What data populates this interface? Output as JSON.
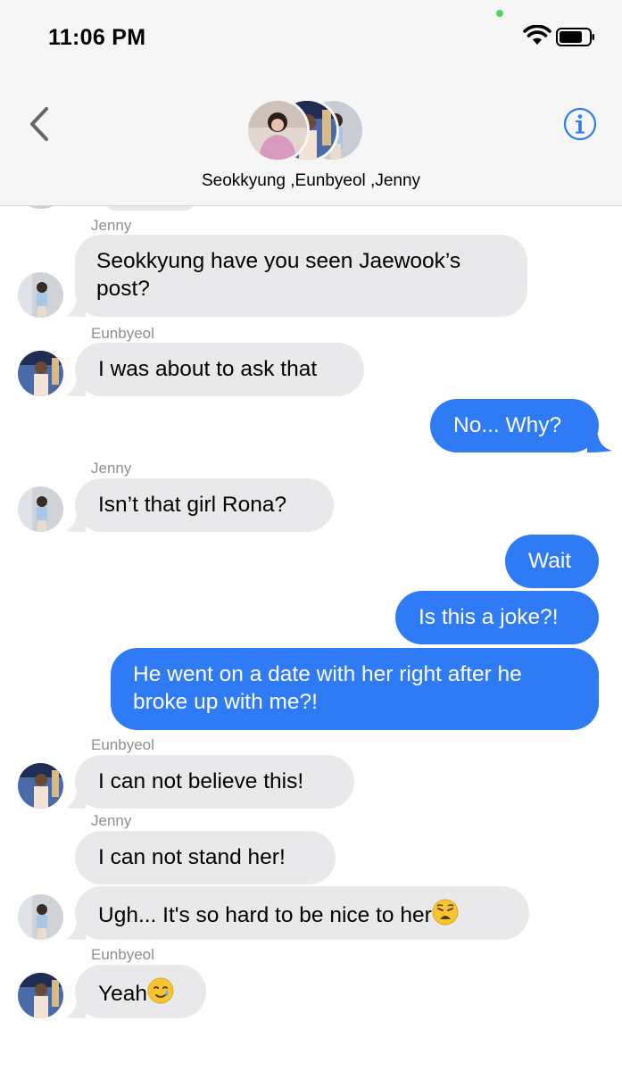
{
  "status_bar": {
    "time": "11:06 PM"
  },
  "nav": {
    "group_names": "Seokkyung ,Eunbyeol ,Jenny"
  },
  "messages": [
    {
      "sender": "Jenny",
      "text": "Seokkyung have you seen Jaewook’s post?",
      "line1": "Seokkyung have you seen Jaewook’s",
      "line2": "post?"
    },
    {
      "sender": "Eunbyeol",
      "text": "I was about to ask that"
    },
    {
      "text": "No... Why?"
    },
    {
      "sender": "Jenny",
      "text": "Isn’t that girl Rona?"
    },
    {
      "text": "Wait"
    },
    {
      "text": "Is this a joke?!"
    },
    {
      "text": "He went on a date with her right after he broke up with me?!",
      "line1": "He went on a date with her right after he",
      "line2": "broke up with me?!"
    },
    {
      "sender": "Eunbyeol",
      "text": "I can not believe this!"
    },
    {
      "sender": "Jenny",
      "text": "I can not stand her!"
    },
    {
      "text": "Ugh... It's so hard to be nice to her"
    },
    {
      "sender": "Eunbyeol",
      "text": "Yeah"
    }
  ],
  "colors": {
    "incoming": "#e9e9eb",
    "outgoing": "#2f7bf5",
    "accent": "#2f7bf5"
  }
}
